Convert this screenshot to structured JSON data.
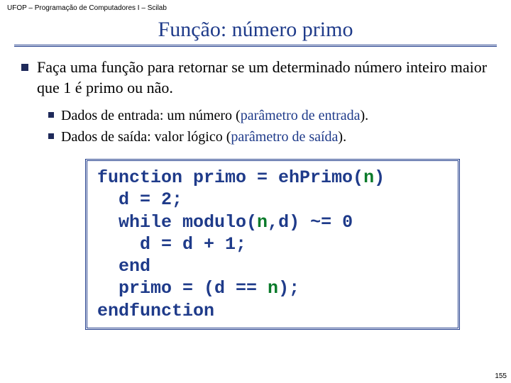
{
  "header": "UFOP – Programação de Computadores I – Scilab",
  "title": "Função: número primo",
  "main_bullet": "Faça uma função para retornar se um determinado número inteiro maior que 1 é primo ou não.",
  "sub1_prefix": "Dados de entrada: um número (",
  "sub1_param": "parâmetro de entrada",
  "sub1_suffix": ").",
  "sub2_prefix": "Dados de saída: valor lógico (",
  "sub2_param": "parâmetro de saída",
  "sub2_suffix": ").",
  "code": {
    "l1a": "function primo = ehPrimo(",
    "l1n": "n",
    "l1b": ")",
    "l2": "  d = 2;",
    "l3a": "  while modulo(",
    "l3n": "n",
    "l3b": ",d) ~= 0",
    "l4": "    d = d + 1;",
    "l5": "  end",
    "l6a": "  primo = (d == ",
    "l6n": "n",
    "l6b": ");",
    "l7": "endfunction"
  },
  "pagenum": "155"
}
